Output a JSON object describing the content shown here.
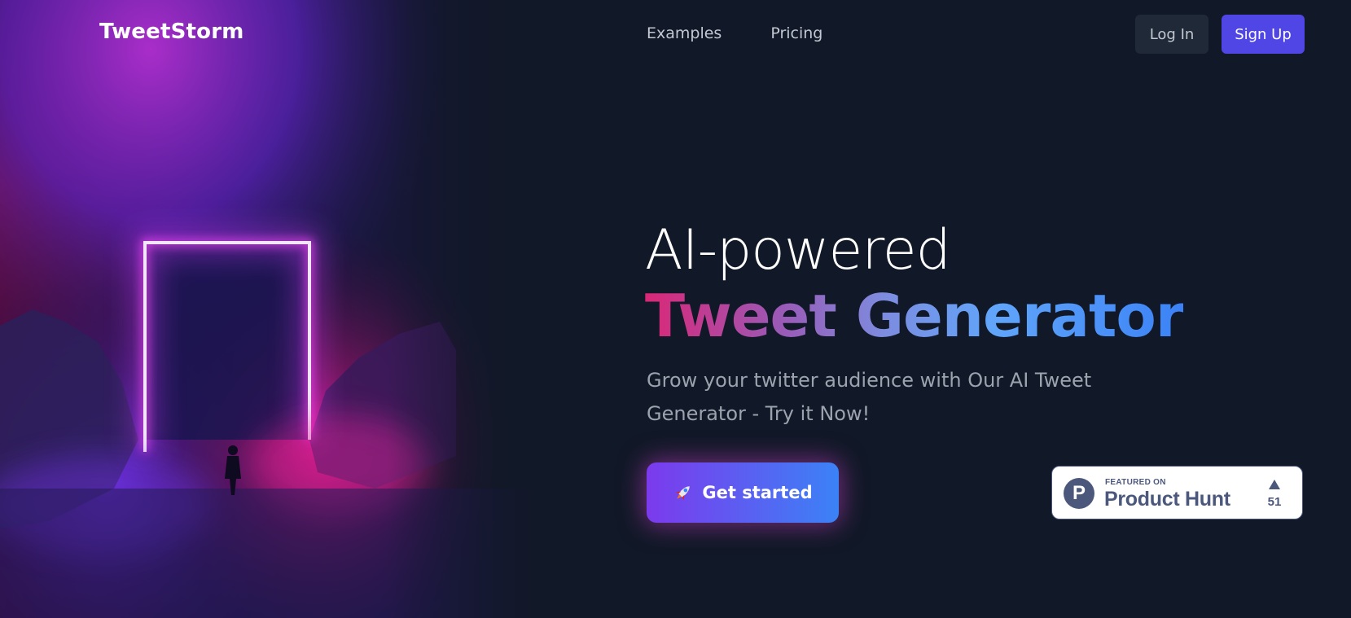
{
  "header": {
    "logo_text": "TweetStorm",
    "nav": [
      {
        "label": "Examples"
      },
      {
        "label": "Pricing"
      }
    ],
    "login_label": "Log In",
    "signup_label": "Sign Up"
  },
  "hero": {
    "headline_line1": "AI-powered",
    "headline_line2": "Tweet Generator",
    "subtitle": "Grow your twitter audience with Our AI Tweet Generator - Try it Now!",
    "cta_label": "Get started",
    "cta_icon": "rocket-icon"
  },
  "product_hunt": {
    "featured_on": "FEATURED ON",
    "name": "Product Hunt",
    "logo_letter": "P",
    "upvotes": "51",
    "brand_color": "#4b587c"
  },
  "colors": {
    "background": "#111827",
    "accent": "#4f46e5",
    "gradient_start": "#db2777",
    "gradient_end": "#3b82f6"
  }
}
